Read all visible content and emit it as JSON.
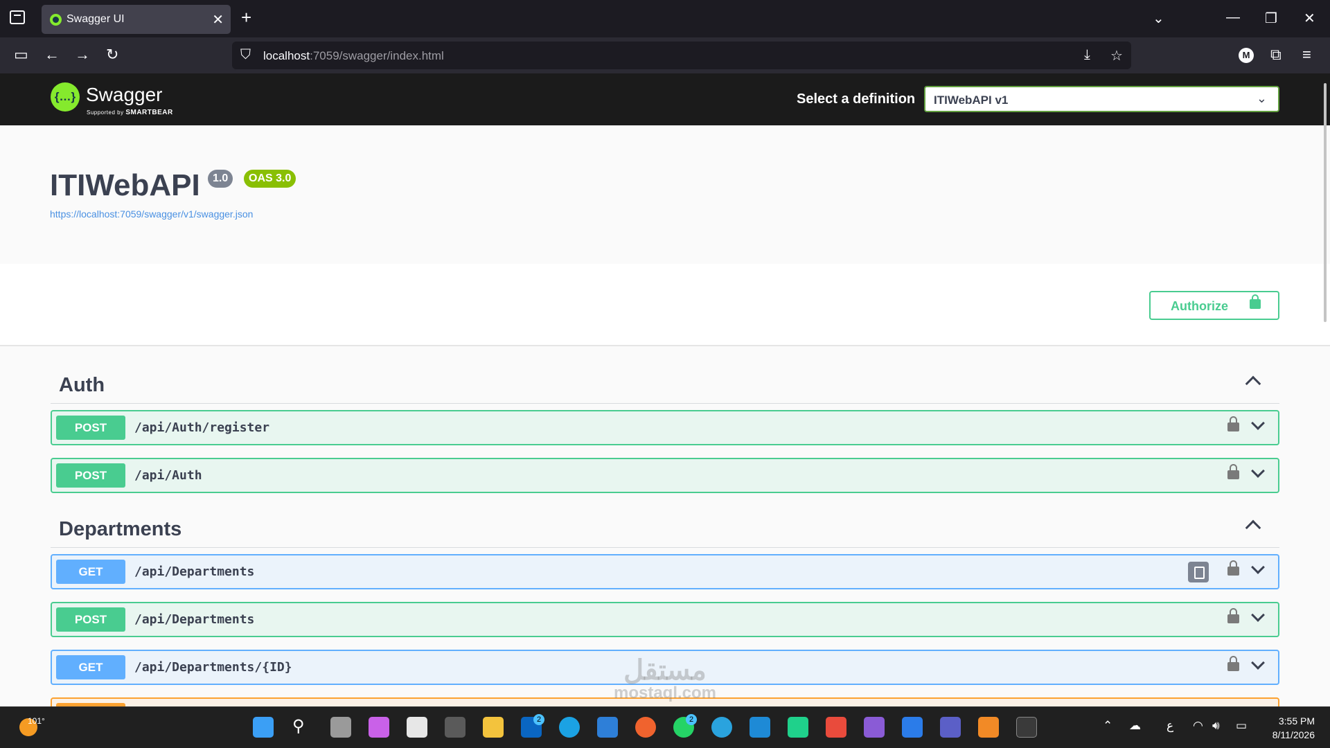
{
  "browser": {
    "tab_title": "Swagger UI",
    "url_host": "localhost",
    "url_rest": ":7059/swagger/index.html"
  },
  "topbar": {
    "logo_text": "Swagger",
    "logo_sub_prefix": "Supported by",
    "logo_sub_brand": "SMARTBEAR",
    "definition_label": "Select a definition",
    "definition_value": "ITIWebAPI v1"
  },
  "info": {
    "title": "ITIWebAPI",
    "version": "1.0",
    "oas": "OAS 3.0",
    "spec_url": "https://localhost:7059/swagger/v1/swagger.json"
  },
  "authorize_label": "Authorize",
  "tags": [
    {
      "name": "Auth",
      "operations": [
        {
          "method": "POST",
          "path": "/api/Auth/register"
        },
        {
          "method": "POST",
          "path": "/api/Auth"
        }
      ]
    },
    {
      "name": "Departments",
      "operations": [
        {
          "method": "GET",
          "path": "/api/Departments"
        },
        {
          "method": "POST",
          "path": "/api/Departments"
        },
        {
          "method": "GET",
          "path": "/api/Departments/{ID}"
        }
      ]
    }
  ],
  "watermark": {
    "arabic": "مستقل",
    "latin": "mostaql.com"
  },
  "taskbar": {
    "weather": "101°",
    "badge_linkedin": "2",
    "badge_whatsapp": "2",
    "lang": "ع",
    "time": "3:55 PM",
    "date": "8/11/2026"
  },
  "colors": {
    "post": "#49cc90",
    "get": "#61affe",
    "put": "#fca130",
    "topbar": "#1b1b1b",
    "select_border": "#62a03f"
  }
}
